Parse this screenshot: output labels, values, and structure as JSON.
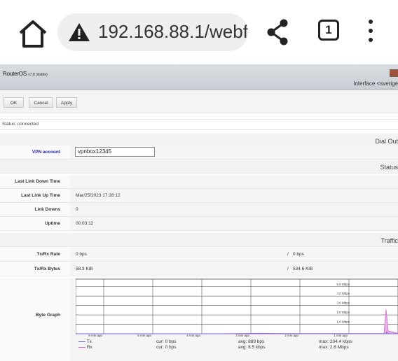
{
  "browser": {
    "url": "192.168.88.1/webf",
    "tab_count": "1",
    "icons": [
      "home-icon",
      "warning-icon",
      "share-icon",
      "tabs-icon",
      "more-vert-icon"
    ]
  },
  "header": {
    "brand": "RouterOS",
    "version": "v7.8 (stable)",
    "title": "Interface <sverige"
  },
  "toolbar": {
    "ok": "OK",
    "cancel": "Cancel",
    "apply": "Apply"
  },
  "status": "Status: connected",
  "sections": {
    "dial_out": "Dial Out",
    "status": "Status",
    "traffic": "Traffic"
  },
  "fields": {
    "vpn_account_label": "VPN account",
    "vpn_account_value": "vpnbox12345",
    "last_link_down_label": "Last Link Down Time",
    "last_link_down_value": "",
    "last_link_up_label": "Last Link Up Time",
    "last_link_up_value": "Mar/25/2023 17:28:12",
    "link_downs_label": "Link Downs",
    "link_downs_value": "0",
    "uptime_label": "Uptime",
    "uptime_value": "00:03:12"
  },
  "traffic": {
    "rate_label": "Tx/Rx Rate",
    "tx_rate": "0 bps",
    "rx_rate": "0 bps",
    "bytes_label": "Tx/Rx Bytes",
    "tx_bytes": "58.3 KiB",
    "rx_bytes": "534.6 KiB",
    "separator": "/",
    "graph_label": "Byte Graph"
  },
  "chart_data": {
    "type": "area",
    "y_ticks": [
      "5.0 Mbps",
      "4.0 Mbps",
      "3.0 Mbps",
      "2.0 Mbps",
      "1.0 Mbps"
    ],
    "x_ticks": [
      "6 min ago",
      "5 min ago",
      "4 min ago",
      "3 min ago",
      "2 min ago",
      "1 min ago"
    ],
    "ylim": [
      0,
      5.8
    ],
    "series": [
      {
        "name": "Tx",
        "color": "#5a5ad6",
        "cur": "cur: 0 bps",
        "avg": "avg: 889 bps",
        "max": "max: 204.4 kbps"
      },
      {
        "name": "Rx",
        "color": "#d36bd3",
        "cur": "cur: 0 bps",
        "avg": "avg: 8.5 kbps",
        "max": "max: 2.6 Mbps"
      }
    ]
  }
}
